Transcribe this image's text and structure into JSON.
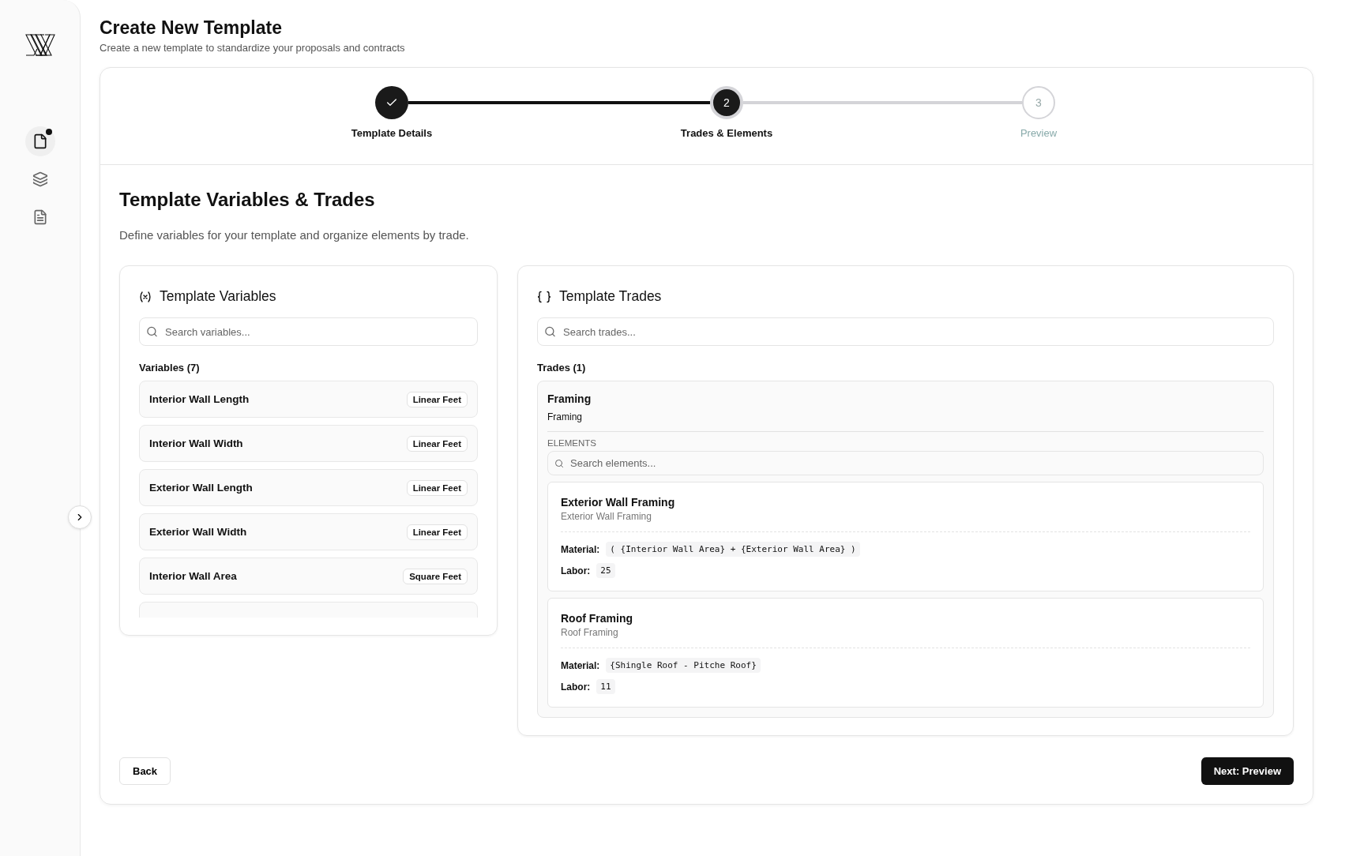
{
  "sidebar": {
    "items": [
      {
        "kind": "file",
        "selected": true,
        "badge": true
      },
      {
        "kind": "layers",
        "selected": false,
        "badge": false
      },
      {
        "kind": "document",
        "selected": false,
        "badge": false
      }
    ]
  },
  "header": {
    "title": "Create New Template",
    "subtitle": "Create a new template to standardize your proposals and contracts"
  },
  "stepper": [
    {
      "label": "Template Details",
      "completed": true,
      "current": false
    },
    {
      "label": "Trades & Elements",
      "completed": false,
      "current": true,
      "number": "2"
    },
    {
      "label": "Preview",
      "completed": false,
      "current": false,
      "number": "3"
    }
  ],
  "section": {
    "title": "Template Variables & Trades",
    "description": "Define variables for your template and organize elements by trade."
  },
  "variables_panel": {
    "title": "Template Variables",
    "search": {
      "placeholder": "Search variables..."
    },
    "count_label": "Variables (7)",
    "variables": [
      {
        "name": "Interior Wall Length",
        "unit": "Linear Feet"
      },
      {
        "name": "Interior Wall Width",
        "unit": "Linear Feet"
      },
      {
        "name": "Exterior Wall Length",
        "unit": "Linear Feet"
      },
      {
        "name": "Exterior Wall Width",
        "unit": "Linear Feet"
      },
      {
        "name": "Interior Wall Area",
        "unit": "Square Feet"
      }
    ]
  },
  "trades_panel": {
    "title": "Template Trades",
    "search": {
      "placeholder": "Search trades..."
    },
    "count_label": "Trades (1)",
    "trades": [
      {
        "name": "Framing",
        "description": "Framing",
        "elements_label": "ELEMENTS",
        "element_search": {
          "placeholder": "Search elements..."
        },
        "elements": [
          {
            "name": "Exterior Wall Framing",
            "description": "Exterior Wall Framing",
            "material_label": "Material:",
            "material": "( {Interior Wall Area} + {Exterior Wall Area} )",
            "labor_label": "Labor:",
            "labor": "25"
          },
          {
            "name": "Roof Framing",
            "description": "Roof Framing",
            "material_label": "Material:",
            "material": "{Shingle Roof - Pitche Roof}",
            "labor_label": "Labor:",
            "labor": "11"
          }
        ]
      }
    ]
  },
  "footer": {
    "back": "Back",
    "next": "Next: Preview"
  }
}
